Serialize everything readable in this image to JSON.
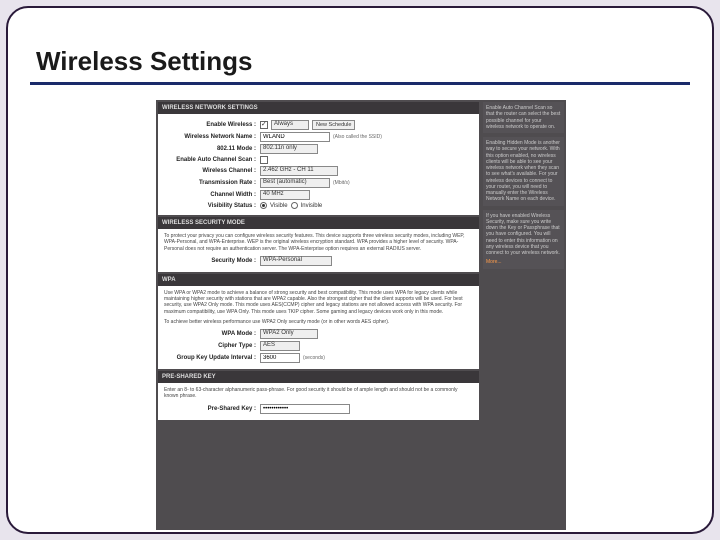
{
  "slide": {
    "title": "Wireless Settings"
  },
  "panels": {
    "network": {
      "header": "WIRELESS NETWORK SETTINGS",
      "rows": {
        "enable_label": "Enable Wireless :",
        "enable_checked": true,
        "enable_schedule": "Always",
        "new_schedule_btn": "New Schedule",
        "name_label": "Wireless Network Name :",
        "name_value": "WLAND",
        "name_hint": "(Also called the SSID)",
        "mode_label": "802.11 Mode :",
        "mode_value": "802.11n only",
        "autoscan_label": "Enable Auto Channel Scan :",
        "autoscan_checked": false,
        "channel_label": "Wireless Channel :",
        "channel_value": "2.462 GHz - CH 11",
        "txrate_label": "Transmission Rate :",
        "txrate_value": "Best (automatic)",
        "txrate_hint": "(Mbit/s)",
        "chwidth_label": "Channel Width :",
        "chwidth_value": "40 MHz",
        "vis_label": "Visibility Status :",
        "vis_visible": "Visible",
        "vis_invisible": "Invisible"
      }
    },
    "security": {
      "header": "WIRELESS SECURITY MODE",
      "desc": "To protect your privacy you can configure wireless security features. This device supports three wireless security modes, including WEP, WPA-Personal, and WPA-Enterprise. WEP is the original wireless encryption standard. WPA provides a higher level of security. WPA-Personal does not require an authentication server. The WPA-Enterprise option requires an external RADIUS server.",
      "mode_label": "Security Mode :",
      "mode_value": "WPA-Personal"
    },
    "wpa": {
      "header": "WPA",
      "desc": "Use WPA or WPA2 mode to achieve a balance of strong security and best compatibility. This mode uses WPA for legacy clients while maintaining higher security with stations that are WPA2 capable. Also the strongest cipher that the client supports will be used. For best security, use WPA2 Only mode. This mode uses AES(CCMP) cipher and legacy stations are not allowed access with WPA security. For maximum compatibility, use WPA Only. This mode uses TKIP cipher. Some gaming and legacy devices work only in this mode.",
      "desc2": "To achieve better wireless performance use WPA2 Only security mode (or in other words AES cipher).",
      "wpamode_label": "WPA Mode :",
      "wpamode_value": "WPA2 Only",
      "cipher_label": "Cipher Type :",
      "cipher_value": "AES",
      "gkui_label": "Group Key Update Interval :",
      "gkui_value": "3600",
      "gkui_hint": "(seconds)"
    },
    "psk": {
      "header": "PRE-SHARED KEY",
      "desc": "Enter an 8- to 63-character alphanumeric pass-phrase. For good security it should be of ample length and should not be a commonly known phrase.",
      "label": "Pre-Shared Key :",
      "value": "••••••••••••"
    }
  },
  "sidebar": {
    "block1": "Enable Auto Channel Scan so that the router can select the best possible channel for your wireless network to operate on.",
    "block2": "Enabling Hidden Mode is another way to secure your network. With this option enabled, no wireless clients will be able to see your wireless network when they scan to see what's available. For your wireless devices to connect to your router, you will need to manually enter the Wireless Network Name on each device.",
    "block3": "If you have enabled Wireless Security, make sure you write down the Key or Passphrase that you have configured. You will need to enter this information on any wireless device that you connect to your wireless network.",
    "more": "More..."
  }
}
